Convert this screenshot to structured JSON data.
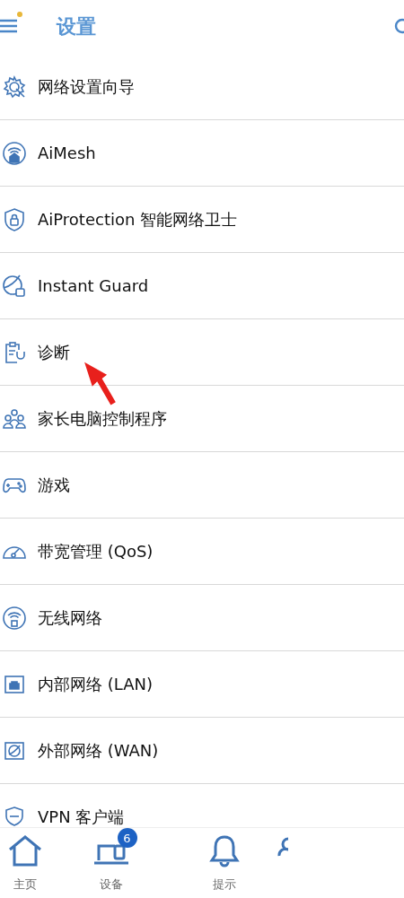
{
  "header": {
    "title": "设置",
    "menu_notification": true
  },
  "items": [
    {
      "label": "网络设置向导"
    },
    {
      "label": "AiMesh"
    },
    {
      "label": "AiProtection 智能网络卫士"
    },
    {
      "label": "Instant Guard"
    },
    {
      "label": "诊断"
    },
    {
      "label": "家长电脑控制程序"
    },
    {
      "label": "游戏"
    },
    {
      "label": "带宽管理 (QoS)"
    },
    {
      "label": "无线网络"
    },
    {
      "label": "内部网络 (LAN)"
    },
    {
      "label": "外部网络 (WAN)"
    },
    {
      "label": "VPN 客户端"
    }
  ],
  "bottom_nav": [
    {
      "kind": "tab",
      "label": "主页"
    },
    {
      "kind": "tab",
      "label": "设备",
      "badge": "6"
    },
    {
      "kind": "tab",
      "label": "提示"
    },
    {
      "kind": "partial"
    }
  ]
}
